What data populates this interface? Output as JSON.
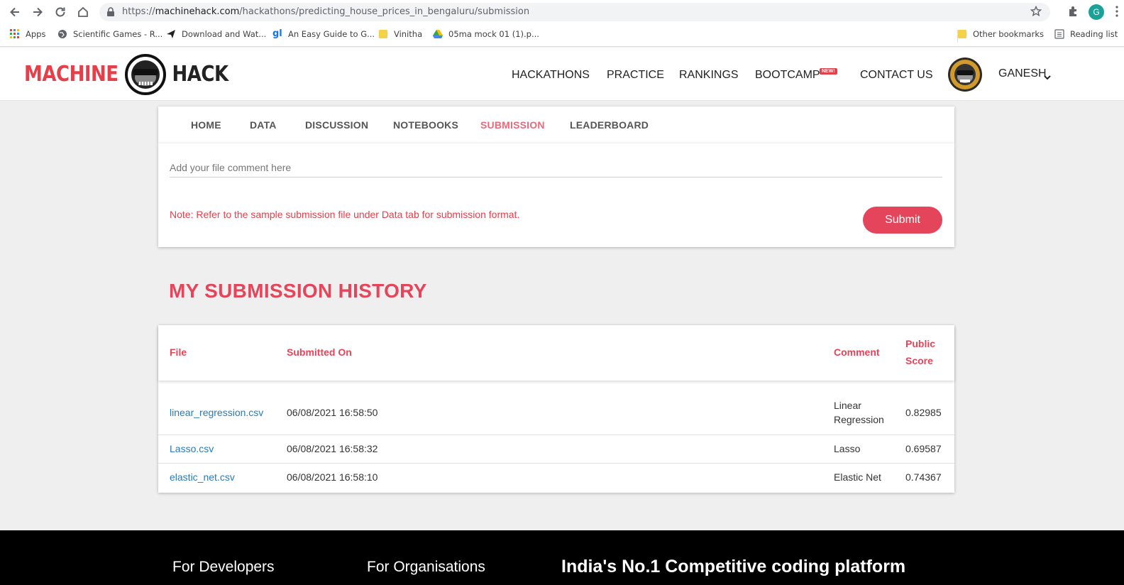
{
  "browser": {
    "url_prefix": "https://",
    "url_host": "machinehack.com",
    "url_path": "/hackathons/predicting_house_prices_in_bengaluru/submission",
    "profile_initial": "G",
    "bookmarks": [
      {
        "label": "Apps",
        "icon": "apps-grid-icon"
      },
      {
        "label": "Scientific Games - R...",
        "icon": "globe-icon"
      },
      {
        "label": "Download and Wat...",
        "icon": "paper-plane-icon"
      },
      {
        "label": "An Easy Guide to G...",
        "icon": "gl-icon"
      },
      {
        "label": "Vinitha",
        "icon": "folder-icon"
      },
      {
        "label": "05ma mock 01 (1).p...",
        "icon": "drive-icon"
      }
    ],
    "other_bookmarks": "Other bookmarks",
    "reading_list": "Reading list"
  },
  "site": {
    "logo_left": "MACHINE",
    "logo_right": "HACK",
    "nav": [
      "HACKATHONS",
      "PRACTICE",
      "RANKINGS",
      "BOOTCAMP",
      "CONTACT US"
    ],
    "new_badge": "NEW!",
    "user_name": "GANESH"
  },
  "tabs": [
    "HOME",
    "DATA",
    "DISCUSSION",
    "NOTEBOOKS",
    "SUBMISSION",
    "LEADERBOARD"
  ],
  "active_tab": "SUBMISSION",
  "form": {
    "comment_placeholder": "Add your file comment here",
    "note": "Note: Refer to the sample submission file under Data tab for submission format.",
    "submit_label": "Submit"
  },
  "history": {
    "title": "MY SUBMISSION HISTORY",
    "columns": {
      "file": "File",
      "submitted_on": "Submitted On",
      "comment": "Comment",
      "score_line1": "Public",
      "score_line2": "Score"
    },
    "rows": [
      {
        "file": "linear_regression.csv",
        "submitted_on": "06/08/2021 16:58:50",
        "comment_line1": "Linear",
        "comment_line2": "Regression",
        "score": "0.82985"
      },
      {
        "file": "Lasso.csv",
        "submitted_on": "06/08/2021 16:58:32",
        "comment_line1": "Lasso",
        "comment_line2": "",
        "score": "0.69587"
      },
      {
        "file": "elastic_net.csv",
        "submitted_on": "06/08/2021 16:58:10",
        "comment_line1": "Elastic Net",
        "comment_line2": "",
        "score": "0.74367"
      }
    ]
  },
  "footer": {
    "developers": "For Developers",
    "organisations": "For Organisations",
    "tagline": "India's No.1 Competitive coding platform"
  },
  "colors": {
    "brand_red": "#e4455a",
    "link_blue": "#2a7ab8",
    "active_tab": "#e86a7c"
  }
}
